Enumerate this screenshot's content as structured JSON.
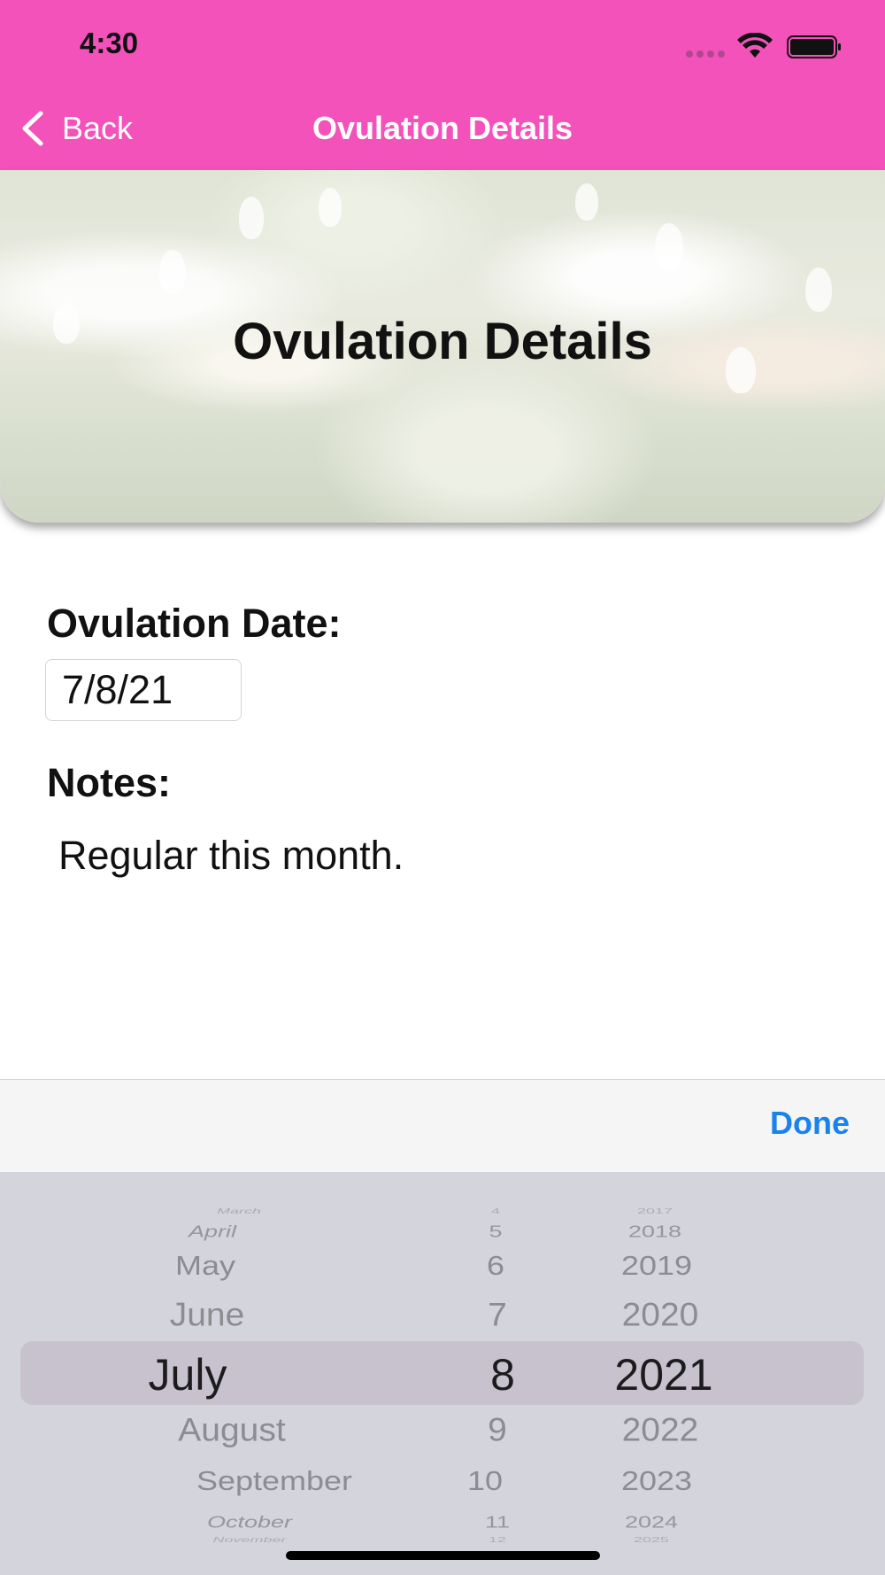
{
  "status_bar": {
    "time": "4:30"
  },
  "nav": {
    "back_label": "Back",
    "title": "Ovulation Details"
  },
  "banner": {
    "title": "Ovulation Details"
  },
  "form": {
    "date_label": "Ovulation Date:",
    "date_value": "7/8/21",
    "notes_label": "Notes:",
    "notes_value": "Regular this month."
  },
  "toolbar": {
    "done_label": "Done"
  },
  "picker": {
    "months": [
      "March",
      "April",
      "May",
      "June",
      "July",
      "August",
      "September",
      "October",
      "November"
    ],
    "days": [
      "4",
      "5",
      "6",
      "7",
      "8",
      "9",
      "10",
      "11",
      "12"
    ],
    "years": [
      "2017",
      "2018",
      "2019",
      "2020",
      "2021",
      "2022",
      "2023",
      "2024",
      "2025"
    ],
    "selected": {
      "month": "July",
      "day": "8",
      "year": "2021"
    }
  },
  "colors": {
    "header": "#f352bb",
    "accent": "#1a82ec",
    "picker_bg": "#d4d5dc"
  },
  "icons": {
    "back": "chevron-left-icon",
    "wifi": "wifi-icon",
    "battery": "battery-icon",
    "signal": "signal-dots-icon"
  }
}
